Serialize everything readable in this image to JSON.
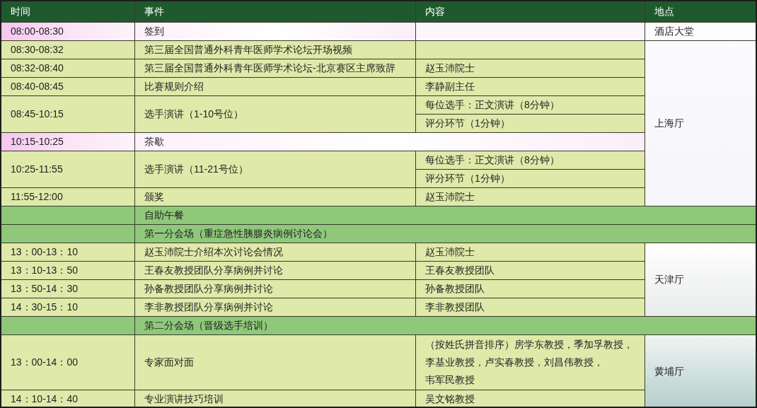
{
  "columns": [
    "时间",
    "事件",
    "内容",
    "地点"
  ],
  "rows": [
    {
      "kind": "break",
      "time": "08:00-08:30",
      "event": "签到",
      "location": "酒店大堂"
    },
    {
      "kind": "session",
      "time": "08:30-08:32",
      "event": "第三届全国普通外科青年医师学术论坛开场视频",
      "location": "上海厅"
    },
    {
      "kind": "session",
      "time": "08:32-08:40",
      "event": "第三届全国普通外科青年医师学术论坛-北京赛区主席致辞",
      "content": [
        [
          "赵玉沛院士"
        ]
      ]
    },
    {
      "kind": "session",
      "time": "08:40-08:45",
      "event": "比赛规则介绍",
      "content": [
        [
          "李静副主任"
        ]
      ]
    },
    {
      "kind": "session",
      "time": "08:45-10:15",
      "event": "选手演讲（1-10号位）",
      "content": [
        [
          "每位选手：正文演讲（8分钟）"
        ],
        [
          "评分环节（1分钟）"
        ]
      ]
    },
    {
      "kind": "break",
      "time": "10:15-10:25",
      "event": "茶歇"
    },
    {
      "kind": "session",
      "time": "10:25-11:55",
      "event": "选手演讲（11-21号位）",
      "content": [
        [
          "每位选手：正文演讲（8分钟）"
        ],
        [
          "评分环节（1分钟）"
        ]
      ]
    },
    {
      "kind": "session",
      "time": "11:55-12:00",
      "event": "颁奖",
      "content": [
        [
          "赵玉沛院士"
        ]
      ]
    },
    {
      "kind": "section",
      "event": "自助午餐"
    },
    {
      "kind": "section",
      "event": "第一分会场（重症急性胰腺炎病例讨论会）"
    },
    {
      "kind": "session",
      "time": "13：00-13：10",
      "event": "赵玉沛院士介绍本次讨论会情况",
      "content": [
        [
          "赵玉沛院士"
        ]
      ],
      "location": "天津厅"
    },
    {
      "kind": "session",
      "time": "13：10-13：50",
      "event": "王春友教授团队分享病例并讨论",
      "content": [
        [
          "王春友教授团队"
        ]
      ]
    },
    {
      "kind": "session",
      "time": "13：50-14：30",
      "event": "孙备教授团队分享病例并讨论",
      "content": [
        [
          "孙备教授团队"
        ]
      ]
    },
    {
      "kind": "session",
      "time": "14：30-15：10",
      "event": "李非教授团队分享病例并讨论",
      "content": [
        [
          "李非教授团队"
        ]
      ]
    },
    {
      "kind": "section",
      "event": "第二分会场（晋级选手培训）"
    },
    {
      "kind": "session",
      "time": "13：00-14：00",
      "event": "专家面对面",
      "content": [
        [
          "（按姓氏拼音排序）房学东教授，季加孚教授，",
          "李基业教授，卢实春教授，刘昌伟教授，",
          "韦军民教授"
        ]
      ],
      "location": "黄埔厅"
    },
    {
      "kind": "session",
      "time": "14：10-14：40",
      "event": "专业演讲技巧培训",
      "content": [
        [
          "吴文铭教授"
        ]
      ]
    }
  ]
}
